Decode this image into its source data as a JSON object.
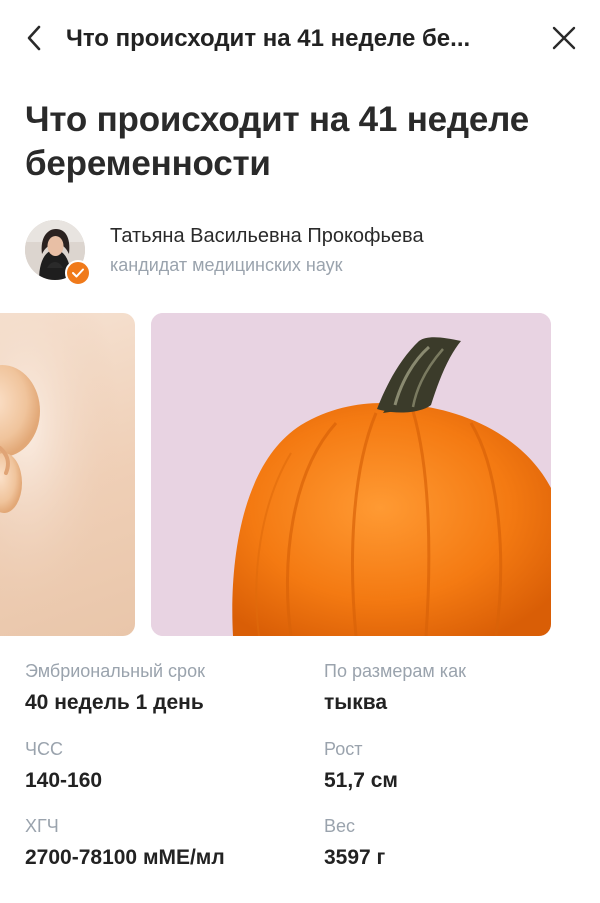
{
  "header": {
    "title": "Что происходит на 41 неделе бе...",
    "back_icon": "chevron-left-icon",
    "close_icon": "close-icon"
  },
  "article": {
    "title": "Что происходит на 41 неделе беременности"
  },
  "author": {
    "name": "Татьяна Васильевна Прокофьева",
    "role": "кандидат медицинских наук",
    "verified_icon": "check-icon",
    "badge_color": "#f07a1a"
  },
  "gallery": {
    "images": [
      "embryo-image",
      "pumpkin-image"
    ]
  },
  "stats": [
    {
      "label": "Эмбриональный срок",
      "value": "40 недель 1 день"
    },
    {
      "label": "По размерам как",
      "value": "тыква"
    },
    {
      "label": "ЧСС",
      "value": "140-160"
    },
    {
      "label": "Рост",
      "value": "51,7 см"
    },
    {
      "label": "ХГЧ",
      "value": "2700-78100 мМЕ/мл"
    },
    {
      "label": "Вес",
      "value": "3597 г"
    }
  ]
}
